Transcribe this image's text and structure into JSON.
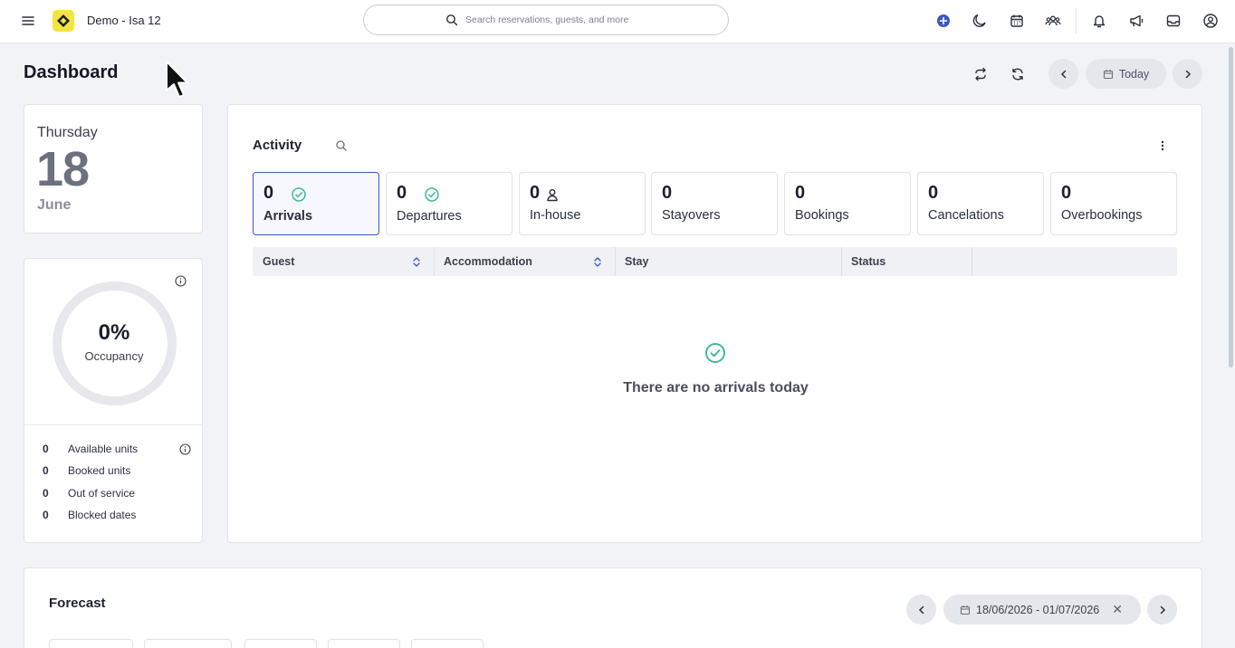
{
  "topbar": {
    "app_title": "Demo - Isa 12",
    "search_placeholder": "Search reservations, guests, and more"
  },
  "page": {
    "title": "Dashboard",
    "today_label": "Today"
  },
  "date_card": {
    "weekday": "Thursday",
    "day": "18",
    "month": "June"
  },
  "occupancy": {
    "percent": "0%",
    "label": "Occupancy",
    "rows": [
      {
        "value": "0",
        "label": "Available units"
      },
      {
        "value": "0",
        "label": "Booked units"
      },
      {
        "value": "0",
        "label": "Out of service"
      },
      {
        "value": "0",
        "label": "Blocked dates"
      }
    ]
  },
  "activity": {
    "title": "Activity",
    "stats": [
      {
        "value": "0",
        "label": "Arrivals",
        "icon": "check-circle-icon"
      },
      {
        "value": "0",
        "label": "Departures",
        "icon": "check-circle-icon"
      },
      {
        "value": "0",
        "label": "In-house",
        "icon": "person-icon"
      },
      {
        "value": "0",
        "label": "Stayovers"
      },
      {
        "value": "0",
        "label": "Bookings"
      },
      {
        "value": "0",
        "label": "Cancelations"
      },
      {
        "value": "0",
        "label": "Overbookings"
      }
    ],
    "columns": [
      "Guest",
      "Accommodation",
      "Stay",
      "Status"
    ],
    "empty_message": "There are no arrivals today"
  },
  "forecast": {
    "title": "Forecast",
    "date_range": "18/06/2026 - 01/07/2026"
  },
  "colors": {
    "accent": "#3b57c4",
    "success": "#3fb99a",
    "logo": "#f2e63d"
  }
}
